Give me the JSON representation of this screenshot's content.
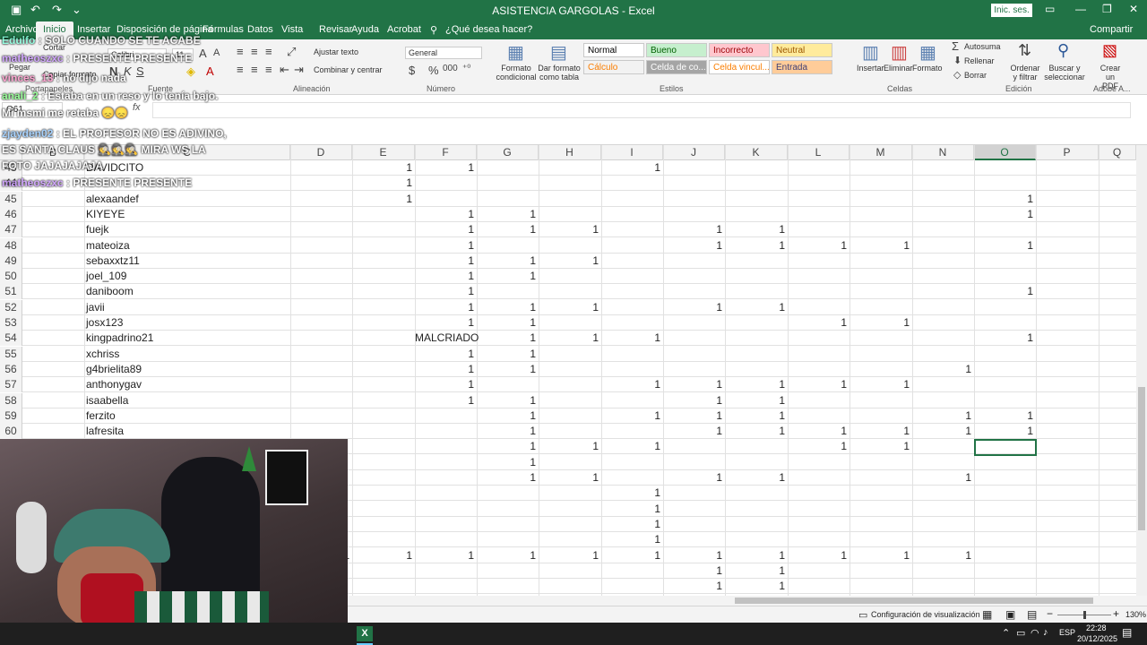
{
  "window": {
    "title": "ASISTENCIA GARGOLAS  -  Excel",
    "signin": "Inic. ses."
  },
  "tabs": [
    "Archivo",
    "Inicio",
    "Insertar",
    "Disposición de página",
    "Fórmulas",
    "Datos",
    "Vista",
    "Revisar",
    "Ayuda",
    "Acrobat"
  ],
  "search": "¿Qué desea hacer?",
  "share": "Compartir",
  "ribbon": {
    "clipboard": {
      "paste": "Pegar",
      "cut": "Cortar",
      "copy": "Copiar formato",
      "label": "Portapapeles"
    },
    "font": {
      "name": "Calibri",
      "size": "11",
      "label": "Fuente"
    },
    "alignment": {
      "wrap": "Ajustar texto",
      "merge": "Combinar y centrar",
      "label": "Alineación"
    },
    "number": {
      "format": "General",
      "label": "Número"
    },
    "styles": {
      "cond": "Formato condicional",
      "table": "Dar formato como tabla",
      "label": "Estilos",
      "cells": [
        {
          "t": "Normal",
          "bg": "#ffffff",
          "fg": "#000000"
        },
        {
          "t": "Bueno",
          "bg": "#c6efce",
          "fg": "#006100"
        },
        {
          "t": "Incorrecto",
          "bg": "#ffc7ce",
          "fg": "#9c0006"
        },
        {
          "t": "Neutral",
          "bg": "#ffeb9c",
          "fg": "#9c5700"
        },
        {
          "t": "Cálculo",
          "bg": "#f2f2f2",
          "fg": "#fa7d00"
        },
        {
          "t": "Celda de co...",
          "bg": "#a5a5a5",
          "fg": "#ffffff"
        },
        {
          "t": "Celda vincul...",
          "bg": "#ffffff",
          "fg": "#fa7d00"
        },
        {
          "t": "Entrada",
          "bg": "#ffcc99",
          "fg": "#3f3f76"
        }
      ]
    },
    "cells": {
      "insert": "Insertar",
      "delete": "Eliminar",
      "format": "Formato",
      "label": "Celdas"
    },
    "editing": {
      "autosum": "Autosuma",
      "fill": "Rellenar",
      "clear": "Borrar",
      "sort": "Ordenar y filtrar",
      "find": "Buscar y seleccionar",
      "label": "Edición"
    },
    "adobe": {
      "create": "Crear un PDF",
      "label": "Adobe A..."
    }
  },
  "namebox": "O61",
  "fx": "fx",
  "columns": [
    "B",
    "C",
    "D",
    "E",
    "F",
    "G",
    "H",
    "I",
    "J",
    "K",
    "L",
    "M",
    "N",
    "O",
    "P",
    "Q"
  ],
  "rows": [
    {
      "n": "43",
      "name": "DAVIDCITO",
      "v": {
        "E": "1",
        "F": "1",
        "I": "1"
      }
    },
    {
      "n": "44",
      "name": "",
      "v": {
        "E": "1"
      }
    },
    {
      "n": "45",
      "name": "alexaandef",
      "v": {
        "E": "1",
        "O": "1"
      }
    },
    {
      "n": "46",
      "name": "KIYEYE",
      "v": {
        "F": "1",
        "G": "1",
        "O": "1"
      }
    },
    {
      "n": "47",
      "name": "fuejk",
      "v": {
        "F": "1",
        "G": "1",
        "H": "1",
        "J": "1",
        "K": "1"
      }
    },
    {
      "n": "48",
      "name": "mateoiza",
      "v": {
        "F": "1",
        "J": "1",
        "K": "1",
        "L": "1",
        "M": "1",
        "O": "1"
      }
    },
    {
      "n": "49",
      "name": "sebaxxtz11",
      "v": {
        "F": "1",
        "G": "1",
        "H": "1"
      }
    },
    {
      "n": "50",
      "name": "joel_109",
      "v": {
        "F": "1",
        "G": "1"
      }
    },
    {
      "n": "51",
      "name": "daniboom",
      "v": {
        "F": "1",
        "O": "1"
      }
    },
    {
      "n": "52",
      "name": "javii",
      "v": {
        "F": "1",
        "G": "1",
        "H": "1",
        "J": "1",
        "K": "1"
      }
    },
    {
      "n": "53",
      "name": "josx123",
      "v": {
        "F": "1",
        "G": "1",
        "L": "1",
        "M": "1"
      }
    },
    {
      "n": "54",
      "name": "kingpadrino21",
      "v": {
        "F": "MALCRIADO",
        "G": "1",
        "H": "1",
        "I": "1",
        "O": "1"
      }
    },
    {
      "n": "55",
      "name": "xchriss",
      "v": {
        "F": "1",
        "G": "1"
      }
    },
    {
      "n": "56",
      "name": "g4brielita89",
      "v": {
        "F": "1",
        "G": "1",
        "N": "1"
      }
    },
    {
      "n": "57",
      "name": "anthonygav",
      "v": {
        "F": "1",
        "I": "1",
        "J": "1",
        "K": "1",
        "L": "1",
        "M": "1"
      }
    },
    {
      "n": "58",
      "name": "isaabella",
      "v": {
        "F": "1",
        "G": "1",
        "J": "1",
        "K": "1"
      }
    },
    {
      "n": "59",
      "name": "ferzito",
      "v": {
        "G": "1",
        "I": "1",
        "J": "1",
        "K": "1",
        "N": "1",
        "O": "1"
      }
    },
    {
      "n": "60",
      "name": "lafresita",
      "v": {
        "G": "1",
        "J": "1",
        "K": "1",
        "L": "1",
        "M": "1",
        "N": "1",
        "O": "1"
      }
    },
    {
      "n": "",
      "name": "",
      "v": {
        "G": "1",
        "H": "1",
        "I": "1",
        "L": "1",
        "M": "1"
      }
    },
    {
      "n": "",
      "name": "",
      "v": {
        "G": "1"
      }
    },
    {
      "n": "",
      "name": "",
      "v": {
        "G": "1",
        "H": "1",
        "J": "1",
        "K": "1",
        "N": "1"
      }
    },
    {
      "n": "",
      "name": "",
      "v": {
        "I": "1"
      }
    },
    {
      "n": "",
      "name": "",
      "v": {
        "I": "1"
      }
    },
    {
      "n": "",
      "name": "",
      "v": {
        "I": "1"
      }
    },
    {
      "n": "",
      "name": "",
      "v": {
        "I": "1"
      }
    },
    {
      "n": "",
      "name": "",
      "v": {
        "D": "1",
        "E": "1",
        "F": "1",
        "G": "1",
        "H": "1",
        "I": "1",
        "J": "1",
        "K": "1",
        "L": "1",
        "M": "1",
        "N": "1"
      }
    },
    {
      "n": "",
      "name": "",
      "v": {
        "J": "1",
        "K": "1"
      }
    },
    {
      "n": "",
      "name": "",
      "v": {
        "J": "1",
        "K": "1"
      }
    }
  ],
  "chat": [
    {
      "user": "Edulfo",
      "msg": "SOLO CUANDO SE TE ACABE"
    },
    {
      "user": "matheoszxc",
      "msg": "PRESENTE PRESENTE"
    },
    {
      "user": "vinces_13",
      "msg": "no dijo nada"
    },
    {
      "user": "anali_2",
      "msg": "Estaba en un reso y lo tenía bajo."
    },
    {
      "user": "",
      "msg": "Mi msmi me retaba 😞😞"
    },
    {
      "user": "zjayden02",
      "msg": "EL PROFESOR NO ES ADIVINO, ES SANTA CLAUS 🕵🕵🕵 MIRA WS LA FOTO JAJAJAJAJA"
    },
    {
      "user": "matheoszxc",
      "msg": "PRESENTE PRESENTE"
    }
  ],
  "status": {
    "view": "Configuración de visualización",
    "zoom": "130%"
  },
  "taskbar": {
    "lang": "ESP",
    "time": "22:28",
    "date": "20/12/2025"
  }
}
